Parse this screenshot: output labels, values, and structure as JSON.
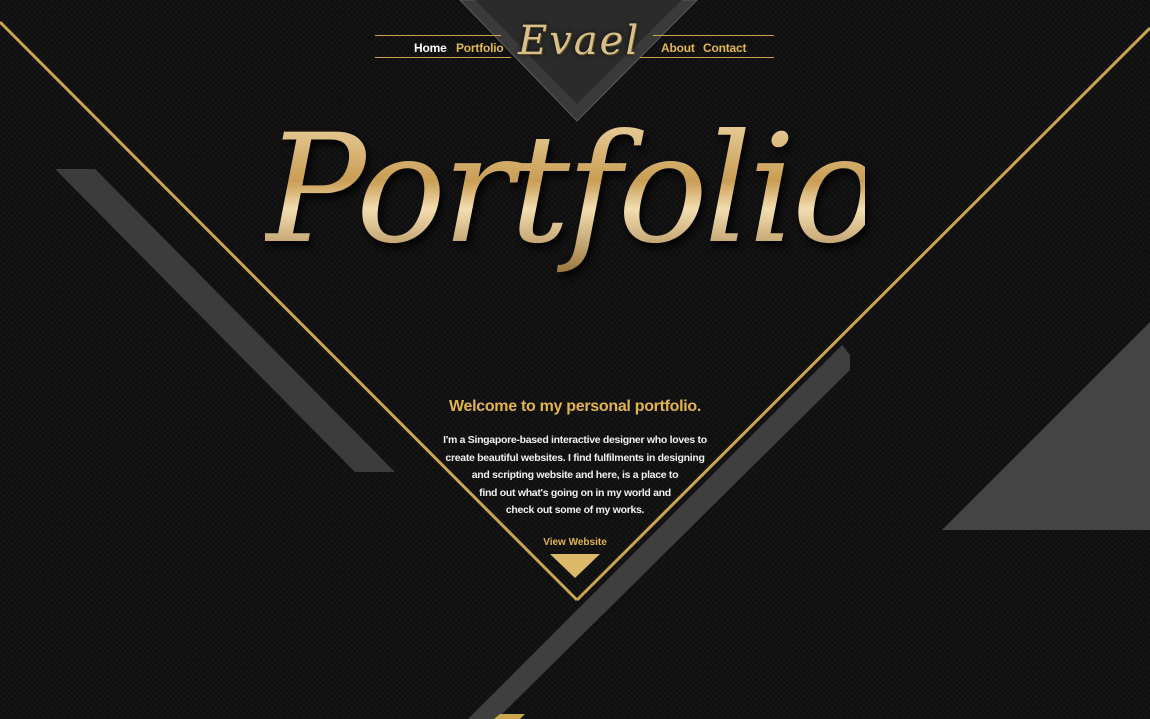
{
  "nav": {
    "home": "Home",
    "portfolio": "Portfolio",
    "about": "About",
    "contact": "Contact"
  },
  "logo": "Evael",
  "hero": {
    "title": "Portfolio",
    "welcome": "Welcome to my personal portfolio.",
    "intro_lines": [
      "I'm a Singapore-based interactive designer who loves to",
      "create beautiful websites. I find fulfilments in designing",
      "and scripting website and here, is a place to",
      "find out what's going on in my world and",
      "check out some of my works."
    ],
    "cta": "View Website"
  },
  "colors": {
    "background": "#0f0f0f",
    "accent_gold": "#e2b44e",
    "line_gold": "#c9a64e",
    "panel_gray": "#3f3f3f"
  }
}
